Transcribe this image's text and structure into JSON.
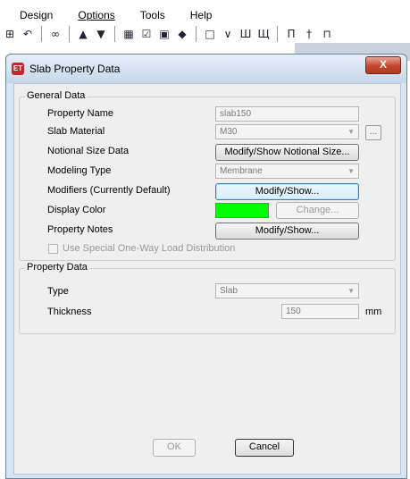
{
  "menubar": {
    "items": [
      {
        "label": "Design",
        "hotkey": ""
      },
      {
        "label": "Options",
        "hotkey": "O"
      },
      {
        "label": "Tools",
        "hotkey": "T"
      },
      {
        "label": "Help",
        "hotkey": "H"
      }
    ]
  },
  "dialog": {
    "title": "Slab Property Data",
    "close_label": "X",
    "general": {
      "group_title": "General Data",
      "property_name_label": "Property Name",
      "property_name_value": "slab150",
      "slab_material_label": "Slab Material",
      "slab_material_value": "M30",
      "material_more_label": "...",
      "notional_size_label": "Notional Size Data",
      "notional_size_button": "Modify/Show Notional Size...",
      "modeling_type_label": "Modeling Type",
      "modeling_type_value": "Membrane",
      "modifiers_label": "Modifiers (Currently Default)",
      "modifiers_button": "Modify/Show...",
      "display_color_label": "Display Color",
      "display_color_value": "#00ff00",
      "change_button": "Change...",
      "property_notes_label": "Property Notes",
      "property_notes_button": "Modify/Show...",
      "one_way_checkbox_label": "Use Special One-Way Load Distribution"
    },
    "property": {
      "group_title": "Property Data",
      "type_label": "Type",
      "type_value": "Slab",
      "thickness_label": "Thickness",
      "thickness_value": "150",
      "thickness_unit": "mm"
    },
    "ok_button": "OK",
    "cancel_button": "Cancel"
  }
}
